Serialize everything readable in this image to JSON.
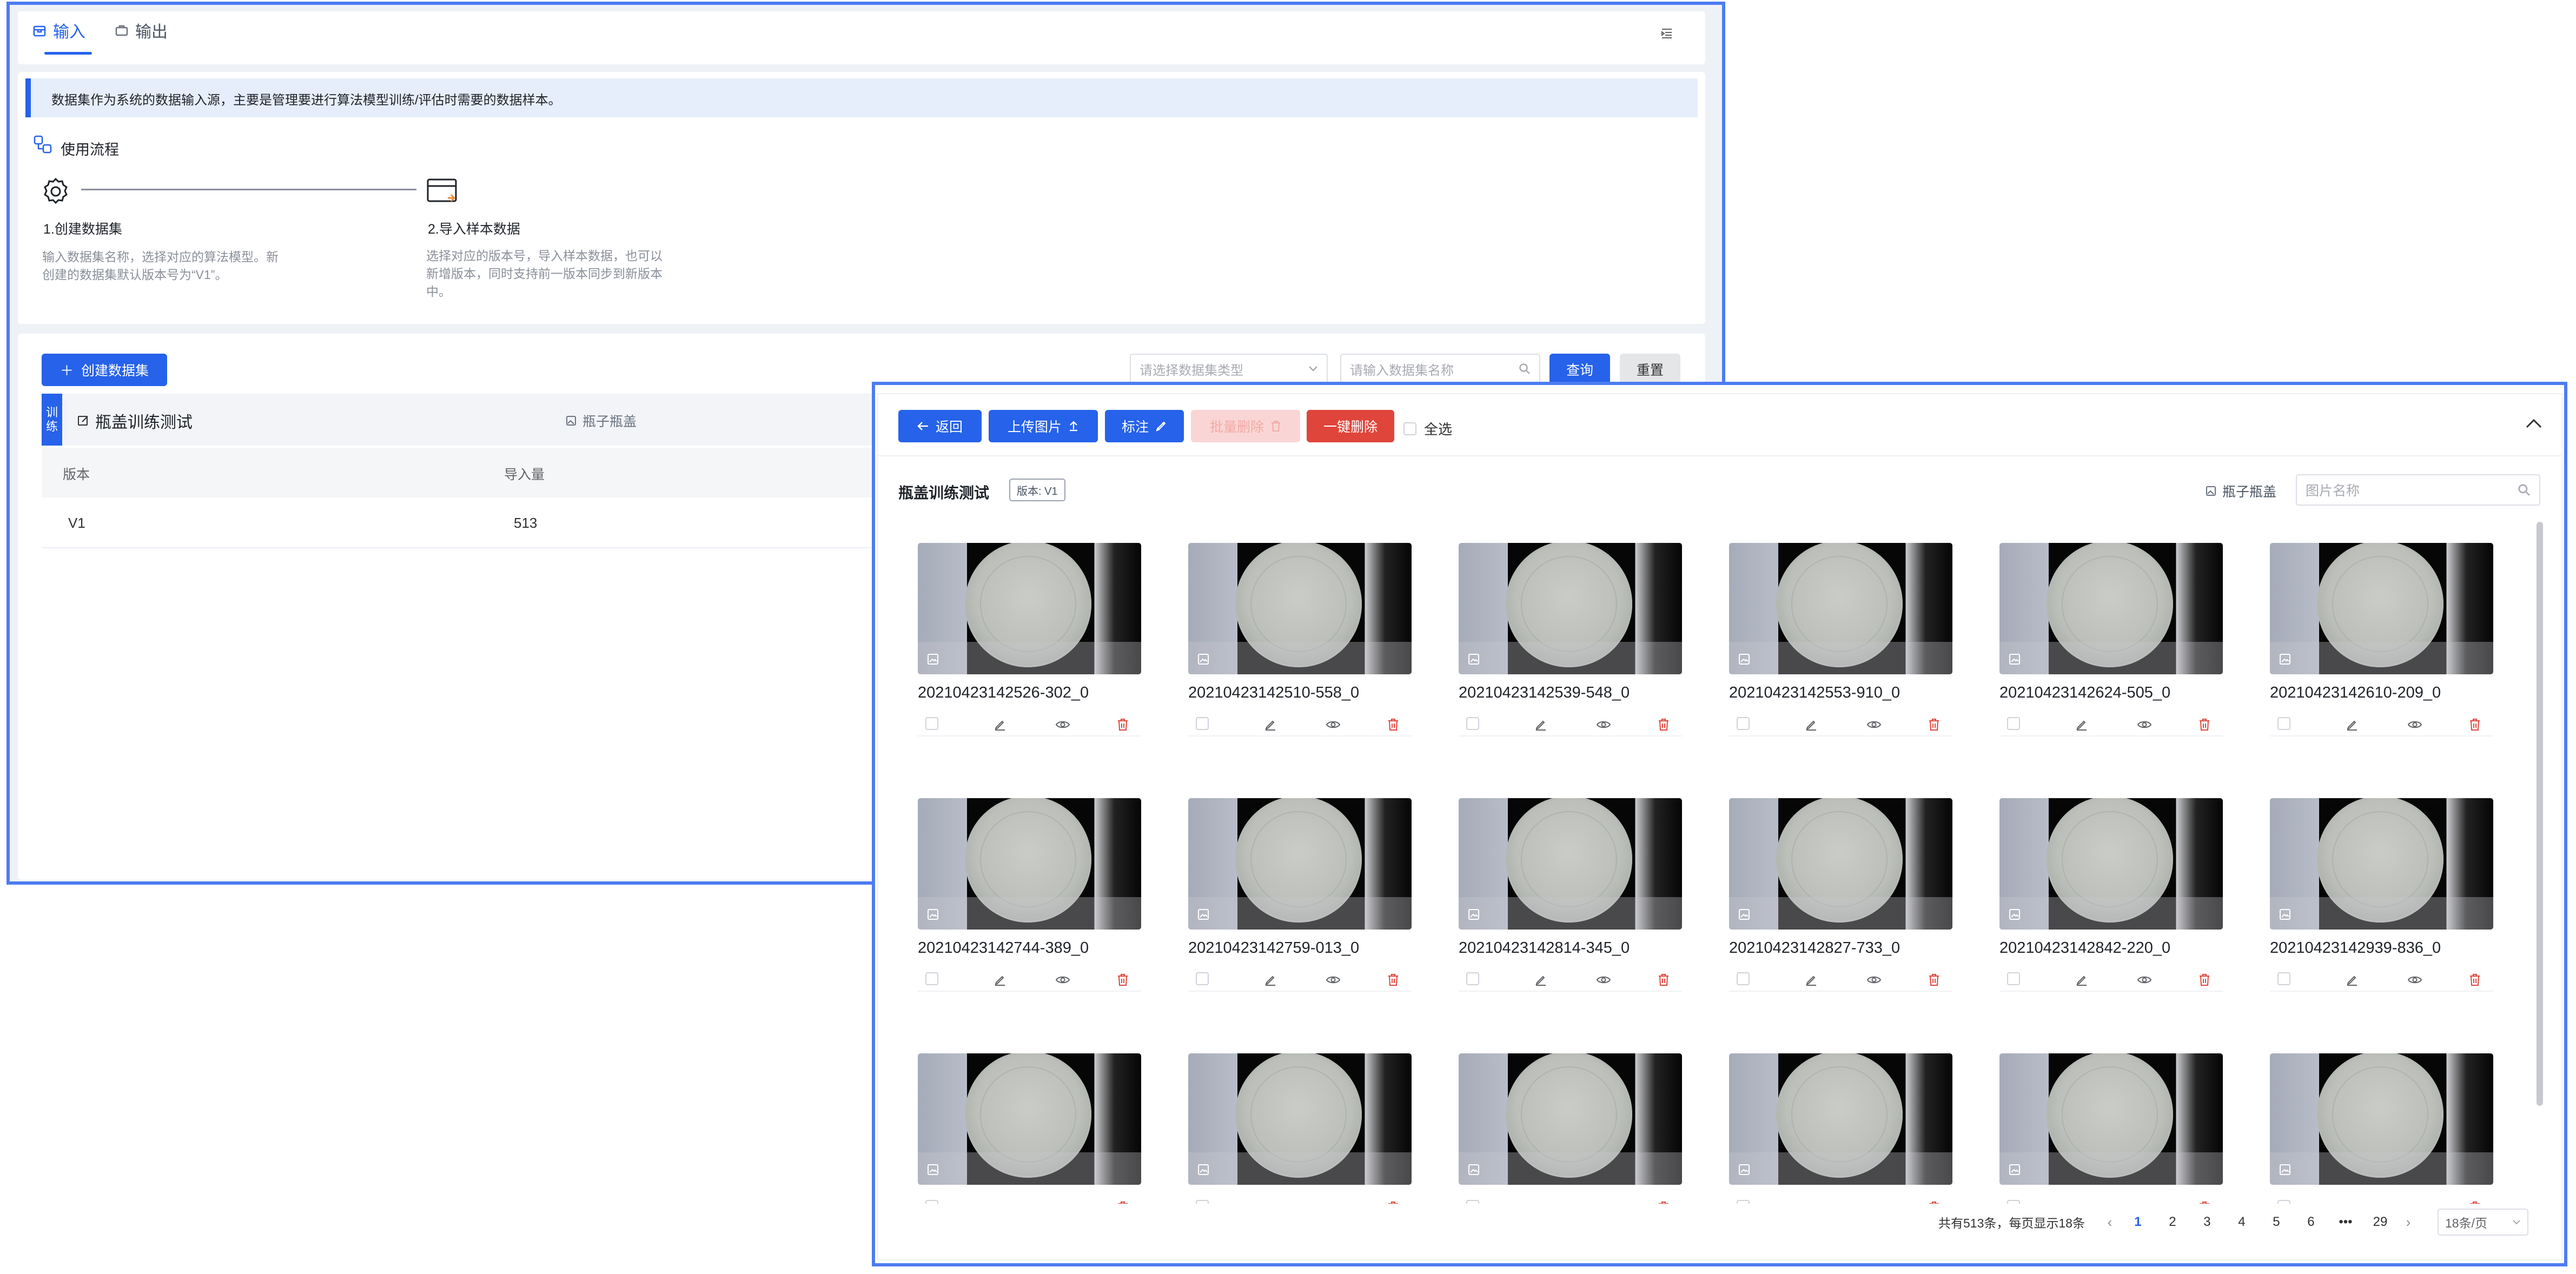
{
  "tabs": {
    "input": "输入",
    "output": "输出"
  },
  "notice": "数据集作为系统的数据输入源，主要是管理要进行算法模型训练/评估时需要的数据样本。",
  "flow": {
    "title": "使用流程",
    "step1_title": "1.创建数据集",
    "step1_desc": "输入数据集名称，选择对应的算法模型。新\n创建的数据集默认版本号为“V1”。",
    "step2_title": "2.导入样本数据",
    "step2_desc": "选择对应的版本号，导入样本数据，也可以\n新增版本，同时支持前一版本同步到新版本\n中。"
  },
  "toolbar": {
    "create_label": "创建数据集",
    "type_placeholder": "请选择数据集类型",
    "name_placeholder": "请输入数据集名称",
    "query_label": "查询",
    "reset_label": "重置"
  },
  "dataset": {
    "badge": "训练",
    "name": "瓶盖训练测试",
    "class_name": "瓶子瓶盖",
    "col_version": "版本",
    "col_count": "导入量",
    "row_version": "V1",
    "row_count": "513"
  },
  "detail": {
    "back_label": "返回",
    "upload_label": "上传图片",
    "annotate_label": "标注",
    "batch_delete_label": "批量删除",
    "delete_all_label": "一键删除",
    "select_all_label": "全选",
    "title": "瓶盖训练测试",
    "version_tag": "版本: V1",
    "class_name": "瓶子瓶盖",
    "search_placeholder": "图片名称"
  },
  "images": [
    "20210423142526-302_0",
    "20210423142510-558_0",
    "20210423142539-548_0",
    "20210423142553-910_0",
    "20210423142624-505_0",
    "20210423142610-209_0",
    "20210423142744-389_0",
    "20210423142759-013_0",
    "20210423142814-345_0",
    "20210423142827-733_0",
    "20210423142842-220_0",
    "20210423142939-836_0",
    "",
    "",
    "",
    "",
    "",
    ""
  ],
  "pagination": {
    "total_text": "共有513条，每页显示18条",
    "pages": [
      "1",
      "2",
      "3",
      "4",
      "5",
      "6",
      "•••",
      "29"
    ],
    "current": "1",
    "page_size": "18条/页"
  },
  "colors": {
    "accent": "#2662ea",
    "danger": "#e0453c",
    "frame": "#4d7cf2"
  }
}
